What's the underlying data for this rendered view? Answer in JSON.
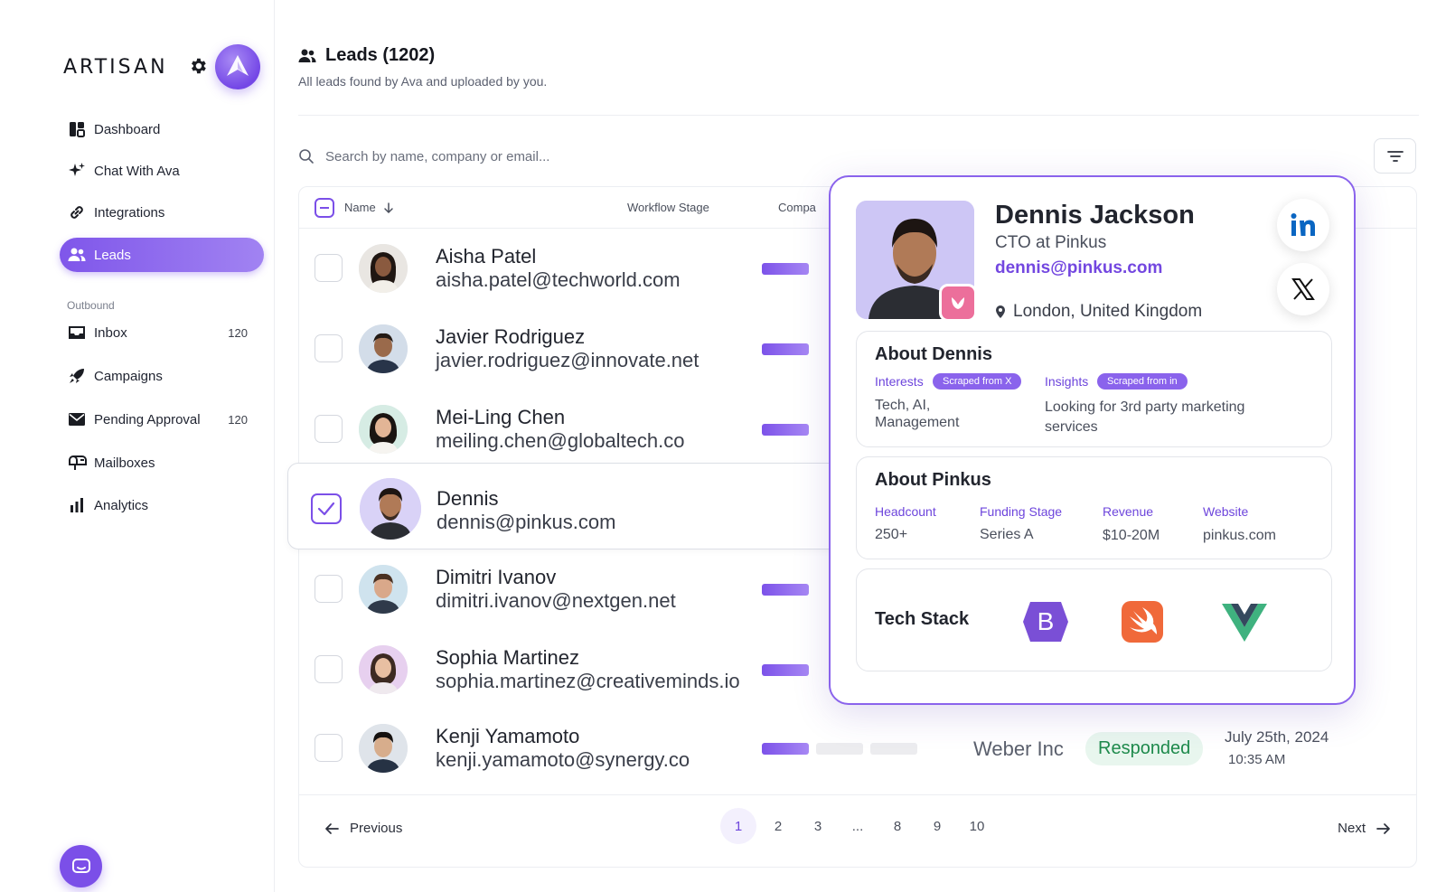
{
  "sidebar": {
    "logo": "ARTISAN",
    "nav": [
      {
        "label": "Dashboard",
        "icon": "dashboard-icon"
      },
      {
        "label": "Chat With Ava",
        "icon": "sparkle-icon"
      },
      {
        "label": "Integrations",
        "icon": "link-icon"
      },
      {
        "label": "Leads",
        "icon": "users-icon",
        "active": true
      }
    ],
    "section_label": "Outbound",
    "outbound": [
      {
        "label": "Inbox",
        "count": "120",
        "icon": "inbox-icon"
      },
      {
        "label": "Campaigns",
        "count": "",
        "icon": "rocket-icon"
      },
      {
        "label": "Pending Approval",
        "count": "120",
        "icon": "envelope-icon"
      },
      {
        "label": "Mailboxes",
        "count": "",
        "icon": "mailbox-icon"
      },
      {
        "label": "Analytics",
        "count": "",
        "icon": "bar-chart-icon"
      }
    ]
  },
  "header": {
    "title": "Leads (1202)",
    "subtitle": "All leads found by Ava and uploaded by you."
  },
  "search": {
    "placeholder": "Search by name, company or email..."
  },
  "table": {
    "columns": {
      "name": "Name",
      "workflow": "Workflow Stage",
      "company": "Compa"
    },
    "rows": [
      {
        "name": "Aisha Patel",
        "email": "aisha.patel@techworld.com",
        "stage": 1,
        "selected": false
      },
      {
        "name": "Javier Rodriguez",
        "email": "javier.rodriguez@innovate.net",
        "stage": 1,
        "selected": false
      },
      {
        "name": "Mei-Ling Chen",
        "email": "meiling.chen@globaltech.co",
        "stage": 1,
        "selected": false
      },
      {
        "name": "Dennis",
        "email": "dennis@pinkus.com",
        "stage": 0,
        "selected": true
      },
      {
        "name": "Dimitri Ivanov",
        "email": "dimitri.ivanov@nextgen.net",
        "stage": 1,
        "selected": false
      },
      {
        "name": "Sophia Martinez",
        "email": "sophia.martinez@creativeminds.io",
        "stage": 1,
        "selected": false
      },
      {
        "name": "Kenji Yamamoto",
        "email": "kenji.yamamoto@synergy.co",
        "stage": 1,
        "selected": false,
        "company": "Weber Inc",
        "status": "Responded",
        "date": "July 25th, 2024",
        "time": "10:35 AM"
      }
    ]
  },
  "pagination": {
    "previous": "Previous",
    "next": "Next",
    "pages": [
      "1",
      "2",
      "3",
      "...",
      "8",
      "9",
      "10"
    ],
    "current": "1"
  },
  "profile": {
    "name": "Dennis Jackson",
    "role": "CTO at Pinkus",
    "email": "dennis@pinkus.com",
    "location": "London, United Kingdom",
    "about_person": {
      "title": "About Dennis",
      "interests_label": "Interests",
      "interests_source": "Scraped from X",
      "interests": "Tech, AI, Management",
      "insights_label": "Insights",
      "insights_source": "Scraped from in",
      "insights": "Looking for 3rd party marketing services"
    },
    "about_company": {
      "title": "About Pinkus",
      "headcount_label": "Headcount",
      "headcount": "250+",
      "funding_label": "Funding Stage",
      "funding": "Series A",
      "revenue_label": "Revenue",
      "revenue": "$10-20M",
      "website_label": "Website",
      "website": "pinkus.com"
    },
    "tech_stack": {
      "title": "Tech Stack",
      "items": [
        "bootstrap-logo",
        "swift-logo",
        "vue-logo"
      ],
      "bootstrap_letter": "B"
    }
  },
  "colors": {
    "accent": "#7b4fe8",
    "status_green": "#1e8a4c"
  }
}
